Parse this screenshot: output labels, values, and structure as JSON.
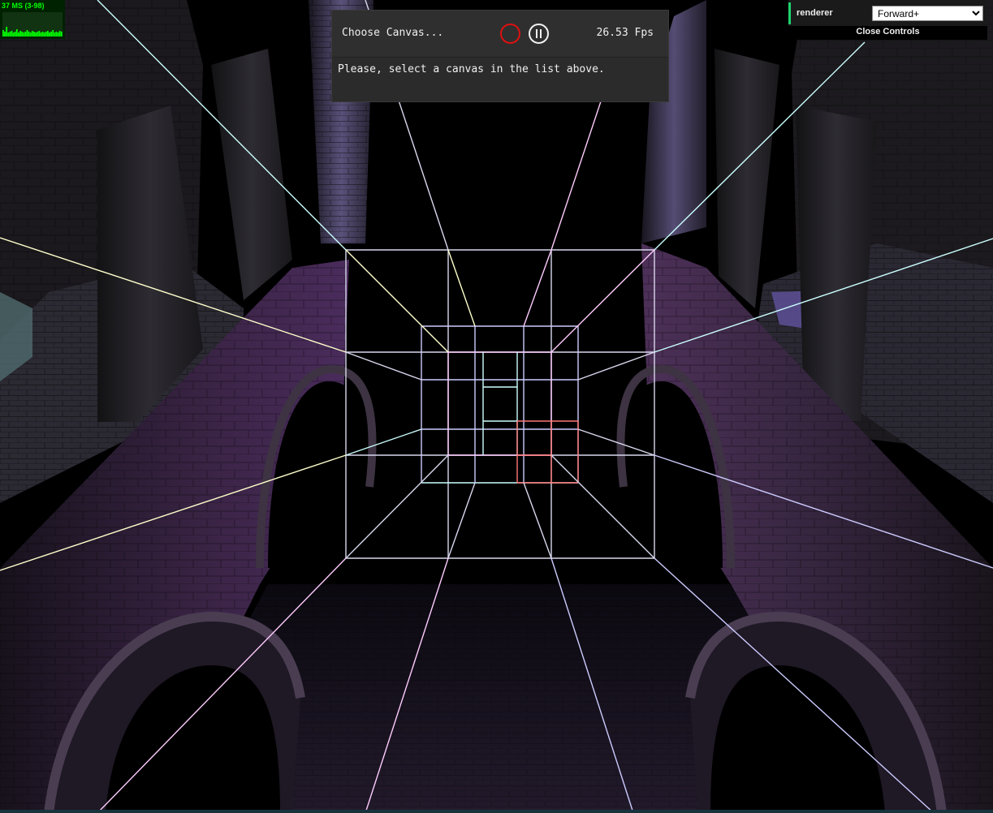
{
  "stats": {
    "label": "37 MS (3-98)",
    "history_ms": [
      8,
      6,
      12,
      5,
      6,
      7,
      5,
      6,
      9,
      5,
      7,
      6,
      5,
      6,
      8,
      6,
      5,
      7,
      6,
      5,
      6,
      7,
      5,
      6,
      5,
      6,
      7,
      5,
      6,
      8,
      5,
      6,
      5,
      7,
      6
    ]
  },
  "spector": {
    "canvas_chooser": "Choose Canvas...",
    "fps": "26.53 Fps",
    "message": "Please, select a canvas in the list above."
  },
  "controls": {
    "renderer_label": "renderer",
    "renderer_options": [
      "Forward+"
    ],
    "renderer_selected": "Forward+",
    "close_label": "Close Controls"
  },
  "scene": {
    "light_colors": [
      "#ffffcc",
      "#ccffff",
      "#ffccff",
      "#ccccff",
      "#ff7777"
    ]
  }
}
